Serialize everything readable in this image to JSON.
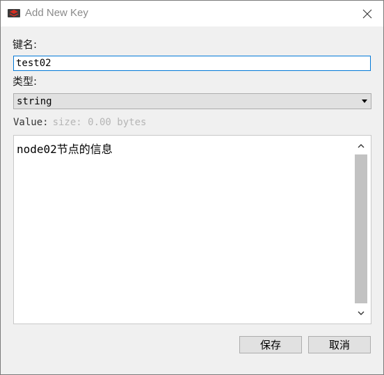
{
  "window": {
    "title": "Add New Key",
    "app_icon": "redis-icon",
    "close_icon": "close-icon"
  },
  "form": {
    "name_label": "键名:",
    "name_value": "test02",
    "type_label": "类型:",
    "type_value": "string",
    "value_label": "Value:",
    "value_size": "size: 0.00 bytes",
    "value_text": "node02节点的信息"
  },
  "buttons": {
    "save": "保存",
    "cancel": "取消"
  },
  "colors": {
    "focus_border": "#0078d7",
    "title_text": "#8a8a8a",
    "scroll_thumb": "#c2c2c2"
  }
}
